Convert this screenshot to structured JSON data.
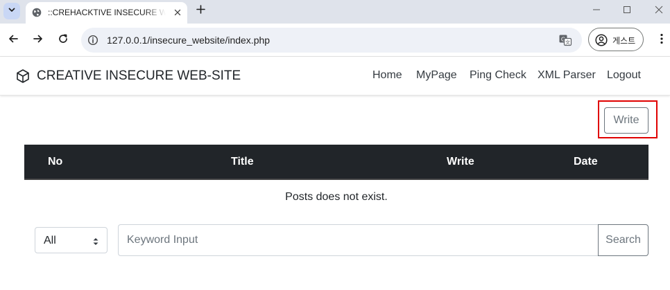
{
  "browser": {
    "tab_title": "::CREHACKTIVE INSECURE WEB-SITE::",
    "url": "127.0.0.1/insecure_website/index.php",
    "profile_label": "게스트"
  },
  "navbar": {
    "brand": "CREATIVE INSECURE WEB-SITE",
    "links": [
      "Home",
      "MyPage",
      "Ping Check",
      "XML Parser",
      "Logout"
    ]
  },
  "actions": {
    "write_label": "Write"
  },
  "table": {
    "headers": [
      "No",
      "Title",
      "Write",
      "Date"
    ],
    "empty_message": "Posts does not exist."
  },
  "search": {
    "filter_value": "All",
    "placeholder": "Keyword Input",
    "button_label": "Search"
  },
  "colors": {
    "table_header_bg": "#212529",
    "highlight": "#e00000",
    "secondary": "#6c757d"
  }
}
